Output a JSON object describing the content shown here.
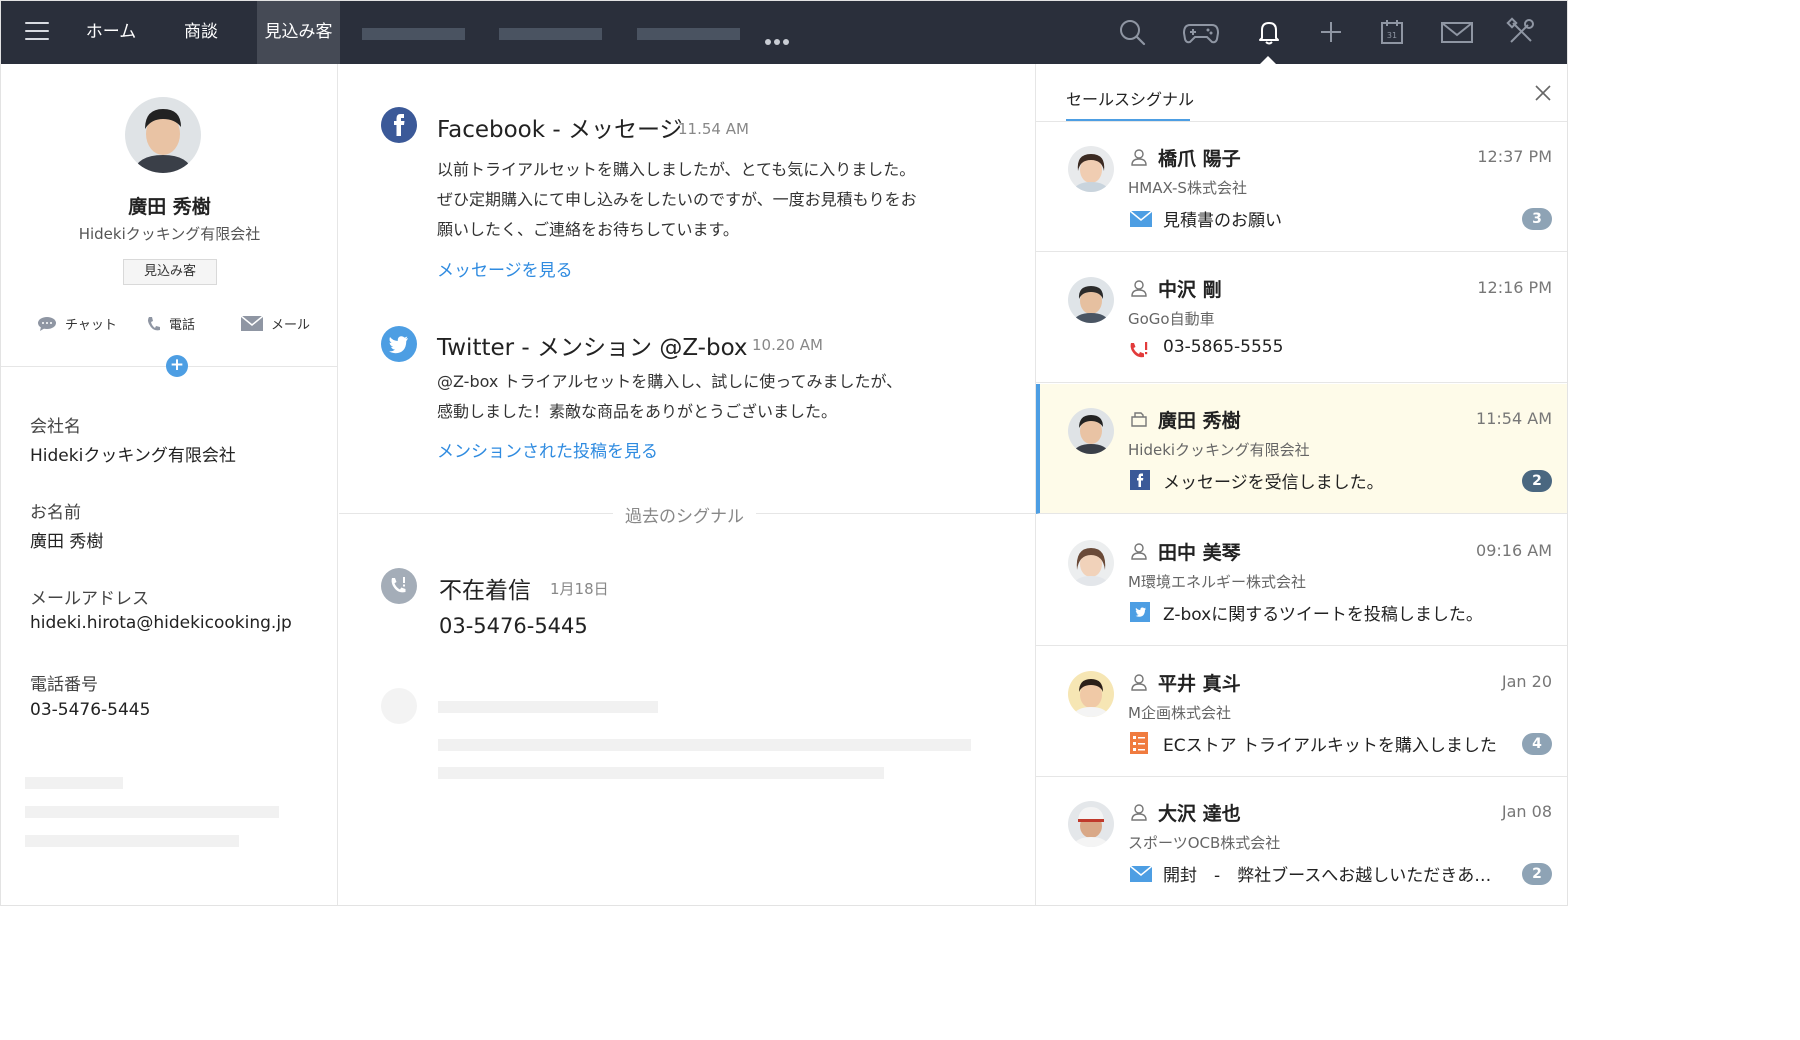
{
  "nav": {
    "tabs": [
      {
        "label": "ホーム"
      },
      {
        "label": "商談"
      },
      {
        "label": "見込み客"
      }
    ],
    "active_tab": 2,
    "icons": [
      "search-icon",
      "gamepad-icon",
      "bell-icon",
      "plus-icon",
      "calendar-icon",
      "mail-icon",
      "tools-icon"
    ],
    "calendar_day": "31"
  },
  "contact": {
    "name": "廣田 秀樹",
    "company": "Hidekiクッキング有限会社",
    "badge": "見込み客",
    "actions": {
      "chat": "チャット",
      "call": "電話",
      "mail": "メール"
    },
    "fields": [
      {
        "label": "会社名",
        "value": "Hidekiクッキング有限会社"
      },
      {
        "label": "お名前",
        "value": "廣田 秀樹"
      },
      {
        "label": "メールアドレス",
        "value": "hideki.hirota@hidekicooking.jp"
      },
      {
        "label": "電話番号",
        "value": "03-5476-5445"
      }
    ]
  },
  "feed": {
    "facebook": {
      "title": "Facebook - メッセージ",
      "time": "11.54 AM",
      "lines": [
        "以前トライアルセットを購入しましたが、とても気に入りました。",
        "ぜひ定期購入にて申し込みをしたいのですが、一度お見積もりをお",
        "願いしたく、ご連絡をお待ちしています。"
      ],
      "link": "メッセージを見る"
    },
    "twitter": {
      "title": "Twitter -  メンション @Z-box",
      "time": "10.20 AM",
      "lines": [
        "@Z-box トライアルセットを購入し、試しに使ってみましたが、",
        "感動しました！素敵な商品をありがとうございました。"
      ],
      "link": "メンションされた投稿を見る"
    },
    "past_label": "過去のシグナル",
    "missed_call": {
      "title": "不在着信",
      "date": "1月18日",
      "number": "03-5476-5445"
    }
  },
  "signals": {
    "title": "セールスシグナル",
    "items": [
      {
        "name": "橋爪 陽子",
        "time": "12:37 PM",
        "company": "HMAX-S株式会社",
        "message": "見積書のお願い",
        "count": "3",
        "msg_icon": "mail-icon",
        "person_icon": "person-icon"
      },
      {
        "name": "中沢 剛",
        "time": "12:16 PM",
        "company": "GoGo自動車",
        "message": "03-5865-5555",
        "count": "",
        "msg_icon": "missed-call-icon",
        "person_icon": "person-icon"
      },
      {
        "name": "廣田 秀樹",
        "time": "11:54 AM",
        "company": "Hidekiクッキング有限会社",
        "message": "メッセージを受信しました。",
        "count": "2",
        "msg_icon": "facebook-icon",
        "person_icon": "lead-icon"
      },
      {
        "name": "田中 美琴",
        "time": "09:16 AM",
        "company": "M環境エネルギー株式会社",
        "message": "Z-boxに関するツイートを投稿しました。",
        "count": "",
        "msg_icon": "twitter-icon",
        "person_icon": "person-icon"
      },
      {
        "name": "平井 真斗",
        "time": "Jan 20",
        "company": "M企画株式会社",
        "message": "ECストア トライアルキットを購入しました",
        "count": "4",
        "msg_icon": "form-icon",
        "person_icon": "person-icon"
      },
      {
        "name": "大沢 達也",
        "time": "Jan 08",
        "company": "スポーツOCB株式会社",
        "message": "開封　-　弊社ブースへお越しいただきあ…",
        "count": "2",
        "msg_icon": "mail-icon",
        "person_icon": "person-icon"
      }
    ],
    "selected_index": 2
  },
  "colors": {
    "topbar": "#2a2f3b",
    "accent": "#4d9ee3",
    "link": "#2f8be0",
    "facebook": "#3b5998",
    "twitter": "#4d9ee3",
    "selected_row": "#fefbe9",
    "badge": "#8ea3b5",
    "missed_call": "#e23b3b",
    "form_icon": "#f07b3f"
  }
}
